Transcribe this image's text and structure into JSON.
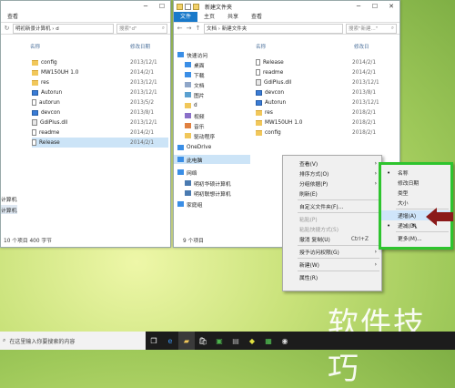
{
  "left_window": {
    "title": "",
    "address": "明初新景计算机 › d",
    "search_placeholder": "搜索\"d\"",
    "columns": {
      "name": "名称",
      "date": "修改日期"
    },
    "files": [
      {
        "name": "config",
        "date": "2013/12/1",
        "icon": "folder-icon"
      },
      {
        "name": "MW150UH 1.0",
        "date": "2014/2/1",
        "icon": "folder-icon"
      },
      {
        "name": "res",
        "date": "2013/12/1",
        "icon": "folder-icon"
      },
      {
        "name": "Autorun",
        "date": "2013/12/1",
        "icon": "exe-icon"
      },
      {
        "name": "autorun",
        "date": "2013/5/2",
        "icon": "file-icon"
      },
      {
        "name": "devcon",
        "date": "2013/8/1",
        "icon": "exe-icon"
      },
      {
        "name": "GdiPlus.dll",
        "date": "2013/12/1",
        "icon": "dll-icon"
      },
      {
        "name": "readme",
        "date": "2014/2/1",
        "icon": "file-icon"
      },
      {
        "name": "Release",
        "date": "2014/2/1",
        "icon": "file-icon"
      }
    ],
    "sidebar_partial": [
      "计算机",
      "计算机"
    ],
    "status": "10 个项目    400 字节"
  },
  "right_window": {
    "title": "新建文件夹",
    "ribbon_tabs": [
      "文件",
      "主页",
      "共享",
      "查看"
    ],
    "address": "文档 › 新建文件夹",
    "search_placeholder": "搜索\"新建...\"",
    "columns": {
      "name": "名称",
      "date": "修改日"
    },
    "sidebar": [
      {
        "label": "快速访问",
        "icon": "star-icon"
      },
      {
        "label": "桌面",
        "icon": "desktop-icon"
      },
      {
        "label": "下载",
        "icon": "download-icon"
      },
      {
        "label": "文档",
        "icon": "document-icon"
      },
      {
        "label": "图片",
        "icon": "picture-icon"
      },
      {
        "label": "d",
        "icon": "folder-icon"
      },
      {
        "label": "视频",
        "icon": "video-icon"
      },
      {
        "label": "音乐",
        "icon": "music-icon"
      },
      {
        "label": "驱动程序",
        "icon": "folder-icon"
      },
      {
        "label": "OneDrive",
        "icon": "cloud-icon"
      },
      {
        "label": "此电脑",
        "icon": "pc-icon"
      },
      {
        "label": "网络",
        "icon": "network-icon"
      },
      {
        "label": "明初华硕计算机",
        "icon": "computer-icon"
      },
      {
        "label": "明初联想计算机",
        "icon": "computer-icon"
      },
      {
        "label": "家庭组",
        "icon": "homegroup-icon"
      }
    ],
    "files": [
      {
        "name": "Release",
        "date": "2014/2/1",
        "icon": "file-icon"
      },
      {
        "name": "readme",
        "date": "2014/2/1",
        "icon": "file-icon"
      },
      {
        "name": "GdiPlus.dll",
        "date": "2013/12/1",
        "icon": "dll-icon"
      },
      {
        "name": "devcon",
        "date": "2013/8/1",
        "icon": "exe-icon"
      },
      {
        "name": "Autorun",
        "date": "2013/12/1",
        "icon": "exe-icon"
      },
      {
        "name": "res",
        "date": "2018/2/1",
        "icon": "folder-icon"
      },
      {
        "name": "MW150UH 1.0",
        "date": "2018/2/1",
        "icon": "folder-icon"
      },
      {
        "name": "config",
        "date": "2018/2/1",
        "icon": "folder-icon"
      }
    ],
    "status": "9 个项目"
  },
  "context_menu": {
    "items": [
      {
        "label": "查看(V)",
        "arrow": true
      },
      {
        "label": "排序方式(O)",
        "arrow": true
      },
      {
        "label": "分组依据(P)",
        "arrow": true
      },
      {
        "label": "刷新(E)"
      },
      {
        "sep": true
      },
      {
        "label": "自定义文件夹(F)..."
      },
      {
        "sep": true
      },
      {
        "label": "粘贴(P)",
        "disabled": true
      },
      {
        "label": "粘贴快捷方式(S)",
        "disabled": true
      },
      {
        "label": "撤消 复制(U)",
        "key": "Ctrl+Z"
      },
      {
        "sep": true
      },
      {
        "label": "授予访问权限(G)",
        "arrow": true
      },
      {
        "sep": true
      },
      {
        "label": "新建(W)",
        "arrow": true
      },
      {
        "sep": true
      },
      {
        "label": "属性(R)"
      }
    ]
  },
  "sort_submenu": {
    "items": [
      {
        "label": "名称",
        "bullet": true
      },
      {
        "label": "修改日期"
      },
      {
        "label": "类型"
      },
      {
        "label": "大小"
      },
      {
        "sep": true
      },
      {
        "label": "递增(A)",
        "highlight": true
      },
      {
        "label": "递减(D)",
        "bullet": true
      },
      {
        "sep": true
      },
      {
        "label": "更多(M)..."
      }
    ]
  },
  "taskbar": {
    "search_text": "在这里输入你要搜索的内容"
  },
  "watermark": "软件技巧",
  "colors": {
    "accent": "#1979ca",
    "highlight_border": "#2ec42e",
    "arrow": "#8b1a1a"
  }
}
